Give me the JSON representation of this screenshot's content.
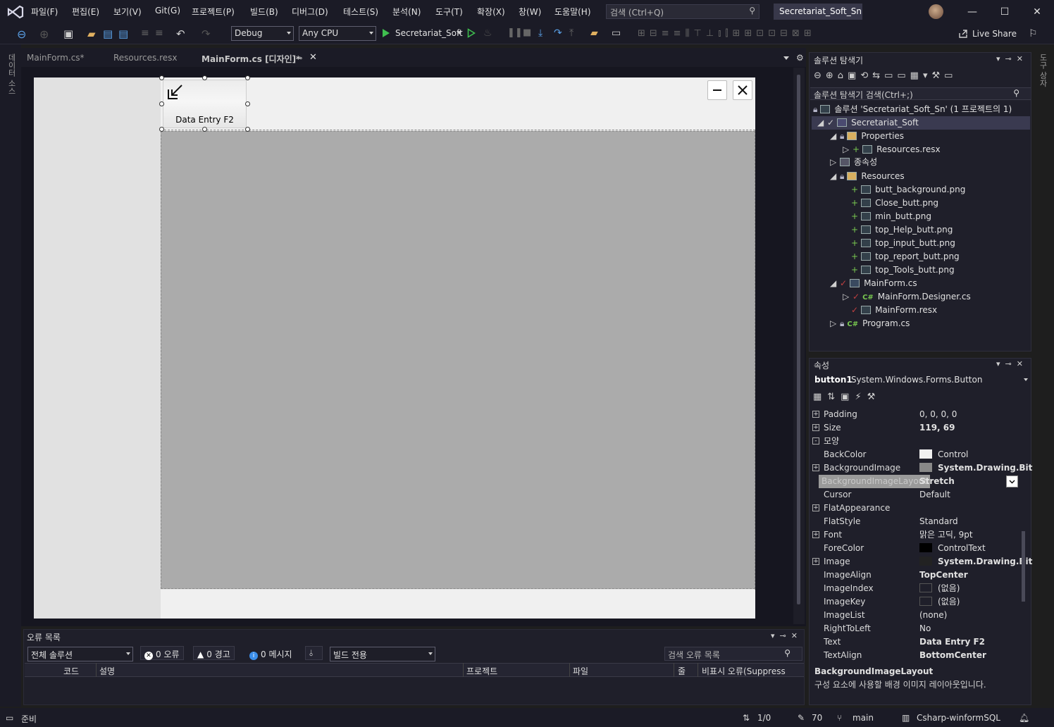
{
  "menu": [
    "파일(F)",
    "편집(E)",
    "보기(V)",
    "Git(G)",
    "프로젝트(P)",
    "빌드(B)",
    "디버그(D)",
    "테스트(S)",
    "분석(N)",
    "도구(T)",
    "확장(X)",
    "창(W)",
    "도움말(H)"
  ],
  "search": {
    "placeholder": "검색 (Ctrl+Q)"
  },
  "solution_title": "Secretariat_Soft_Sn",
  "toolbar": {
    "config": "Debug",
    "platform": "Any CPU",
    "run_target": "Secretariat_Soft",
    "live_share": "Live Share"
  },
  "left_tool_label": "데이터 소스",
  "right_tool_label": "도구 상자",
  "doc_tabs": [
    {
      "label": "MainForm.cs*"
    },
    {
      "label": "Resources.resx"
    },
    {
      "label": "MainForm.cs [디자인]*"
    }
  ],
  "designer": {
    "button_text": "Data Entry F2"
  },
  "error_list": {
    "title": "오류 목록",
    "scope": "전체 솔루션",
    "errors": "0 오류",
    "warnings": "0 경고",
    "messages": "0 메시지",
    "build_filter": "빌드 전용",
    "search_placeholder": "검색 오류 목록",
    "columns": [
      "코드",
      "설명",
      "프로젝트",
      "파일",
      "줄",
      "비표시 오류(Suppress"
    ]
  },
  "solution_explorer": {
    "title": "솔루션 탐색기",
    "search_placeholder": "솔루션 탐색기 검색(Ctrl+;)",
    "solution_line": "솔루션 'Secretariat_Soft_Sn' (1 프로젝트의 1)",
    "project": "Secretariat_Soft",
    "properties": "Properties",
    "resources_resx": "Resources.resx",
    "dependencies": "종속성",
    "resources_folder": "Resources",
    "resource_files": [
      "butt_background.png",
      "Close_butt.png",
      "min_butt.png",
      "top_Help_butt.png",
      "top_input_butt.png",
      "top_report_butt.png",
      "top_Tools_butt.png"
    ],
    "mainform": "MainForm.cs",
    "designer_cs": "MainForm.Designer.cs",
    "mainform_resx": "MainForm.resx",
    "program": "Program.cs"
  },
  "properties": {
    "title": "속성",
    "object_name": "button1",
    "object_type": "System.Windows.Forms.Button",
    "rows": [
      {
        "name": "Padding",
        "value": "0, 0, 0, 0",
        "expand": "+",
        "bold": false,
        "swatch": ""
      },
      {
        "name": "Size",
        "value": "119, 69",
        "expand": "+",
        "bold": true,
        "swatch": ""
      },
      {
        "name": "모양",
        "value": "",
        "expand": "-",
        "bold": false,
        "swatch": "",
        "category": true
      },
      {
        "name": "BackColor",
        "value": "Control",
        "expand": "",
        "bold": false,
        "swatch": "#f0f0f0"
      },
      {
        "name": "BackgroundImage",
        "value": "System.Drawing.Bit",
        "expand": "+",
        "bold": true,
        "swatch": "#888888"
      },
      {
        "name": "BackgroundImageLayout",
        "value": "Stretch",
        "expand": "",
        "bold": true,
        "swatch": "",
        "selected": true
      },
      {
        "name": "Cursor",
        "value": "Default",
        "expand": "",
        "bold": false,
        "swatch": ""
      },
      {
        "name": "FlatAppearance",
        "value": "",
        "expand": "+",
        "bold": false,
        "swatch": ""
      },
      {
        "name": "FlatStyle",
        "value": "Standard",
        "expand": "",
        "bold": false,
        "swatch": ""
      },
      {
        "name": "Font",
        "value": "맑은 고딕, 9pt",
        "expand": "+",
        "bold": false,
        "swatch": ""
      },
      {
        "name": "ForeColor",
        "value": "ControlText",
        "expand": "",
        "bold": false,
        "swatch": "#000000"
      },
      {
        "name": "Image",
        "value": "System.Drawing.Bit",
        "expand": "+",
        "bold": true,
        "swatch": "#222222"
      },
      {
        "name": "ImageAlign",
        "value": "TopCenter",
        "expand": "",
        "bold": true,
        "swatch": ""
      },
      {
        "name": "ImageIndex",
        "value": "(없음)",
        "expand": "",
        "bold": false,
        "swatch": "#1f1f2a"
      },
      {
        "name": "ImageKey",
        "value": "(없음)",
        "expand": "",
        "bold": false,
        "swatch": "#1f1f2a"
      },
      {
        "name": "ImageList",
        "value": "(none)",
        "expand": "",
        "bold": false,
        "swatch": ""
      },
      {
        "name": "RightToLeft",
        "value": "No",
        "expand": "",
        "bold": false,
        "swatch": ""
      },
      {
        "name": "Text",
        "value": "Data Entry F2",
        "expand": "",
        "bold": true,
        "swatch": ""
      },
      {
        "name": "TextAlign",
        "value": "BottomCenter",
        "expand": "",
        "bold": true,
        "swatch": ""
      }
    ],
    "desc_title": "BackgroundImageLayout",
    "desc_text": "구성 요소에 사용할 배경 이미지 레이아웃입니다."
  },
  "status": {
    "ready": "준비",
    "line_info": "1/0",
    "edits": "70",
    "branch": "main",
    "repo": "Csharp-winformSQL"
  },
  "colors": {
    "accent": "#8a63d2",
    "run_green": "#3fbf4f",
    "bg": "#1e1e1e",
    "chrome": "#1b1b26"
  }
}
